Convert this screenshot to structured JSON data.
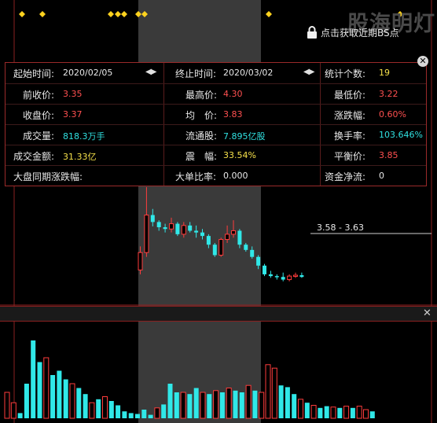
{
  "watermark": "股海明灯",
  "lock_note": "点击获取近期BS点",
  "stats": {
    "start_label": "起始时间:",
    "start_value": "2020/02/05",
    "end_label": "终止时间:",
    "end_value": "2020/03/02",
    "count_label": "统计个数:",
    "count_value": "19",
    "prev_close_label": "前收价:",
    "prev_close_value": "3.35",
    "high_label": "最高价:",
    "high_value": "4.30",
    "low_label": "最低价:",
    "low_value": "3.22",
    "close_label": "收盘价:",
    "close_value": "3.37",
    "avg_label": "均　价:",
    "avg_value": "3.83",
    "change_label": "涨跌幅:",
    "change_value": "0.60%",
    "volume_label": "成交量:",
    "volume_value": "818.3万手",
    "float_label": "流通股:",
    "float_value": "7.895亿股",
    "turnover_label": "换手率:",
    "turnover_value": "103.646%",
    "amount_label": "成交金额:",
    "amount_value": "31.33亿",
    "amplitude_label": "震　幅:",
    "amplitude_value": "33.54%",
    "balance_label": "平衡价:",
    "balance_value": "3.85",
    "market_label": "大盘同期涨跌幅:",
    "bigorder_label": "大单比率:",
    "bigorder_value": "0.000",
    "netflow_label": "资金净流:",
    "netflow_value": "0",
    "nav_glyph": "◀▶"
  },
  "range_label": "3.58 - 3.63",
  "close_glyph": "✕",
  "colors": {
    "up": "#ff3c3c",
    "down": "#30e8e8",
    "highlight": "#3a3a3a",
    "diamond": "#ffd21e"
  },
  "chart_data": {
    "type": "candlestick",
    "highlight_period": [
      "2020/02/05",
      "2020/03/02"
    ],
    "selection_range": [
      3.58,
      3.63
    ],
    "candles_visible": [
      {
        "o": 3.35,
        "h": 3.62,
        "l": 3.3,
        "c": 3.55,
        "up": true
      },
      {
        "o": 3.55,
        "h": 4.3,
        "l": 3.5,
        "c": 3.98,
        "up": true
      },
      {
        "o": 3.98,
        "h": 4.05,
        "l": 3.85,
        "c": 3.9,
        "up": false
      },
      {
        "o": 3.9,
        "h": 3.92,
        "l": 3.8,
        "c": 3.84,
        "up": false
      },
      {
        "o": 3.84,
        "h": 3.88,
        "l": 3.78,
        "c": 3.82,
        "up": false
      },
      {
        "o": 3.82,
        "h": 3.95,
        "l": 3.78,
        "c": 3.88,
        "up": true
      },
      {
        "o": 3.88,
        "h": 3.9,
        "l": 3.74,
        "c": 3.76,
        "up": false
      },
      {
        "o": 3.76,
        "h": 3.9,
        "l": 3.72,
        "c": 3.86,
        "up": true
      },
      {
        "o": 3.86,
        "h": 3.9,
        "l": 3.78,
        "c": 3.8,
        "up": false
      },
      {
        "o": 3.8,
        "h": 3.86,
        "l": 3.72,
        "c": 3.78,
        "up": false
      },
      {
        "o": 3.78,
        "h": 3.82,
        "l": 3.7,
        "c": 3.74,
        "up": false
      },
      {
        "o": 3.74,
        "h": 3.76,
        "l": 3.6,
        "c": 3.64,
        "up": false
      },
      {
        "o": 3.64,
        "h": 3.66,
        "l": 3.5,
        "c": 3.52,
        "up": false
      },
      {
        "o": 3.52,
        "h": 3.72,
        "l": 3.5,
        "c": 3.7,
        "up": true
      },
      {
        "o": 3.7,
        "h": 3.86,
        "l": 3.66,
        "c": 3.76,
        "up": true
      },
      {
        "o": 3.76,
        "h": 3.92,
        "l": 3.72,
        "c": 3.8,
        "up": true
      },
      {
        "o": 3.8,
        "h": 3.82,
        "l": 3.6,
        "c": 3.64,
        "up": false
      },
      {
        "o": 3.64,
        "h": 3.66,
        "l": 3.56,
        "c": 3.58,
        "up": false
      },
      {
        "o": 3.58,
        "h": 3.62,
        "l": 3.48,
        "c": 3.5,
        "up": false
      },
      {
        "o": 3.5,
        "h": 3.52,
        "l": 3.36,
        "c": 3.4,
        "up": false
      },
      {
        "o": 3.4,
        "h": 3.42,
        "l": 3.28,
        "c": 3.3,
        "up": false
      },
      {
        "o": 3.3,
        "h": 3.34,
        "l": 3.26,
        "c": 3.28,
        "up": false
      },
      {
        "o": 3.28,
        "h": 3.3,
        "l": 3.24,
        "c": 3.27,
        "up": false
      },
      {
        "o": 3.27,
        "h": 3.32,
        "l": 3.22,
        "c": 3.24,
        "up": false
      },
      {
        "o": 3.24,
        "h": 3.3,
        "l": 3.22,
        "c": 3.28,
        "up": true
      },
      {
        "o": 3.28,
        "h": 3.32,
        "l": 3.26,
        "c": 3.29,
        "up": true
      },
      {
        "o": 3.29,
        "h": 3.32,
        "l": 3.26,
        "c": 3.27,
        "up": false
      }
    ],
    "volumes": [
      {
        "v": 30,
        "up": true
      },
      {
        "v": 18,
        "up": true
      },
      {
        "v": 6,
        "up": false
      },
      {
        "v": 40,
        "up": false
      },
      {
        "v": 90,
        "up": false
      },
      {
        "v": 65,
        "up": false
      },
      {
        "v": 70,
        "up": true
      },
      {
        "v": 50,
        "up": false
      },
      {
        "v": 55,
        "up": false
      },
      {
        "v": 45,
        "up": false
      },
      {
        "v": 40,
        "up": true
      },
      {
        "v": 35,
        "up": false
      },
      {
        "v": 28,
        "up": false
      },
      {
        "v": 18,
        "up": true
      },
      {
        "v": 22,
        "up": false
      },
      {
        "v": 25,
        "up": true
      },
      {
        "v": 20,
        "up": false
      },
      {
        "v": 15,
        "up": false
      },
      {
        "v": 8,
        "up": false
      },
      {
        "v": 6,
        "up": false
      },
      {
        "v": 5,
        "up": false
      },
      {
        "v": 10,
        "up": false
      },
      {
        "v": 4,
        "up": false
      },
      {
        "v": 12,
        "up": true
      },
      {
        "v": 16,
        "up": false
      },
      {
        "v": 40,
        "up": false
      },
      {
        "v": 30,
        "up": false
      },
      {
        "v": 30,
        "up": true
      },
      {
        "v": 28,
        "up": false
      },
      {
        "v": 35,
        "up": false
      },
      {
        "v": 30,
        "up": true
      },
      {
        "v": 28,
        "up": false
      },
      {
        "v": 32,
        "up": true
      },
      {
        "v": 30,
        "up": false
      },
      {
        "v": 35,
        "up": true
      },
      {
        "v": 32,
        "up": false
      },
      {
        "v": 30,
        "up": false
      },
      {
        "v": 38,
        "up": true
      },
      {
        "v": 32,
        "up": false
      },
      {
        "v": 30,
        "up": true
      },
      {
        "v": 62,
        "up": true
      },
      {
        "v": 58,
        "up": true
      },
      {
        "v": 38,
        "up": false
      },
      {
        "v": 36,
        "up": false
      },
      {
        "v": 28,
        "up": false
      },
      {
        "v": 22,
        "up": true
      },
      {
        "v": 18,
        "up": false
      },
      {
        "v": 15,
        "up": true
      },
      {
        "v": 12,
        "up": false
      },
      {
        "v": 14,
        "up": false
      },
      {
        "v": 13,
        "up": true
      },
      {
        "v": 12,
        "up": false
      },
      {
        "v": 14,
        "up": true
      },
      {
        "v": 12,
        "up": false
      },
      {
        "v": 14,
        "up": true
      },
      {
        "v": 10,
        "up": true
      },
      {
        "v": 8,
        "up": false
      }
    ],
    "bs_marker_count": 9
  }
}
